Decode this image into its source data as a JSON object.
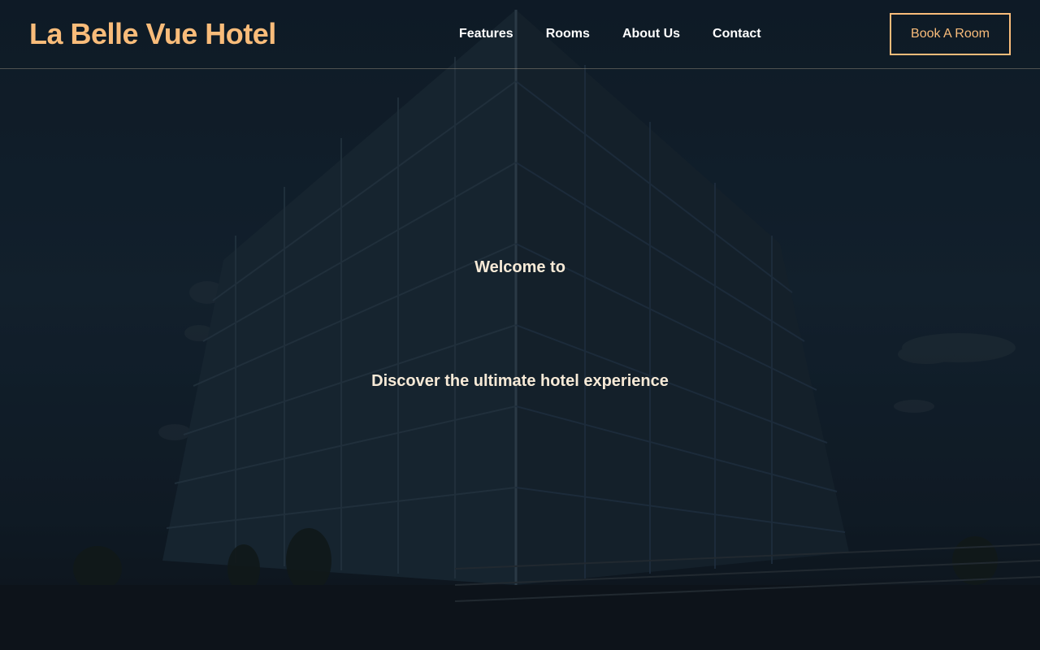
{
  "navbar": {
    "brand": "La Belle Vue Hotel",
    "links": [
      "Features",
      "Rooms",
      "About Us",
      "Contact"
    ],
    "cta_label": "Book A Room"
  },
  "hero": {
    "welcome": "Welcome to",
    "tagline": "Discover the ultimate hotel experience"
  },
  "colors": {
    "accent": "#f9bc7a",
    "hero_text": "#f7ead7",
    "nav_text": "#ffffff",
    "overlay": "#0d1821"
  }
}
